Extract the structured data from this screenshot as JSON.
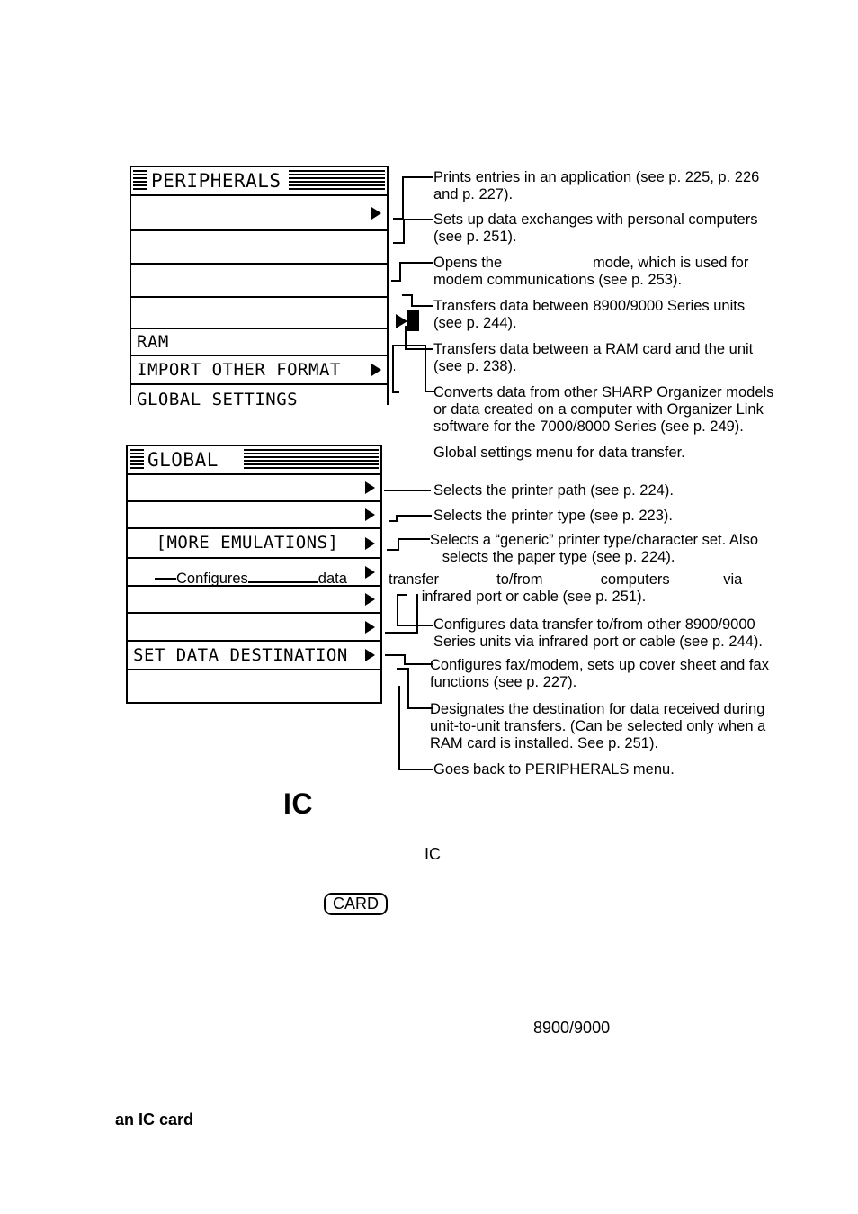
{
  "document": {
    "kind": "scanned-manual-page"
  },
  "menus": {
    "peripherals": {
      "title": "PERIPHERALS",
      "rows": [
        {
          "label": "",
          "arrow": true
        },
        {
          "label": "",
          "arrow": false
        },
        {
          "label": "",
          "arrow": false
        },
        {
          "label": "",
          "arrow": false
        },
        {
          "label": "RAM",
          "arrow": false
        },
        {
          "label": "IMPORT OTHER FORMAT",
          "arrow": true
        },
        {
          "label": "GLOBAL SETTINGS",
          "arrow": false
        }
      ]
    },
    "global": {
      "title": "GLOBAL",
      "rows": [
        {
          "label": "",
          "arrow": true
        },
        {
          "label": "",
          "arrow": true
        },
        {
          "label": "[MORE EMULATIONS]",
          "arrow": true
        },
        {
          "label": "",
          "arrow": true
        },
        {
          "label": "",
          "arrow": true
        },
        {
          "label": "",
          "arrow": true
        },
        {
          "label": "SET DATA DESTINATION",
          "arrow": true
        },
        {
          "label": "",
          "arrow": false
        }
      ]
    }
  },
  "annotations": {
    "peripherals": [
      "Prints entries in an application (see p. 225, p. 226\nand p. 227).",
      "Sets up data exchanges with personal computers\n(see p. 251).",
      "Opens the                      mode, which is used for\nmodem communications (see p. 253).",
      "Transfers data between 8900/9000 Series units\n(see p. 244).",
      "Transfers data between a RAM card and the unit\n(see p. 238).",
      "Converts data from other SHARP Organizer models\nor data created on a computer with Organizer Link\nsoftware for the 7000/8000 Series (see p. 249).",
      "Global settings menu for data transfer."
    ],
    "global": [
      "Selects the printer path (see p. 224).",
      "Selects the printer type (see p. 223).",
      "Selects a “generic” printer type/character set. Also\n   selects the paper type (see p. 224).",
      "transfer              to/from              computers             via\n        infrared port or cable (see p. 251).",
      "Configures data transfer to/from other 8900/9000\nSeries units via infrared port or cable (see p. 244).",
      "Configures fax/modem, sets up cover sheet and fax\nfunctions (see p. 227).",
      "Designates the destination for data received during\nunit-to-unit transfers. (Can be selected only when a\nRAM card is installed. See p. 251).",
      "Goes back to PERIPHERALS menu."
    ]
  },
  "overlay": {
    "configures_prefix": "Configures",
    "configures_suffix": "data"
  },
  "body": {
    "heading_ic": "IC",
    "inline_ic": "IC",
    "keycap_card": "CARD",
    "series_number": "8900/9000",
    "an_ic_card": "an IC card"
  }
}
